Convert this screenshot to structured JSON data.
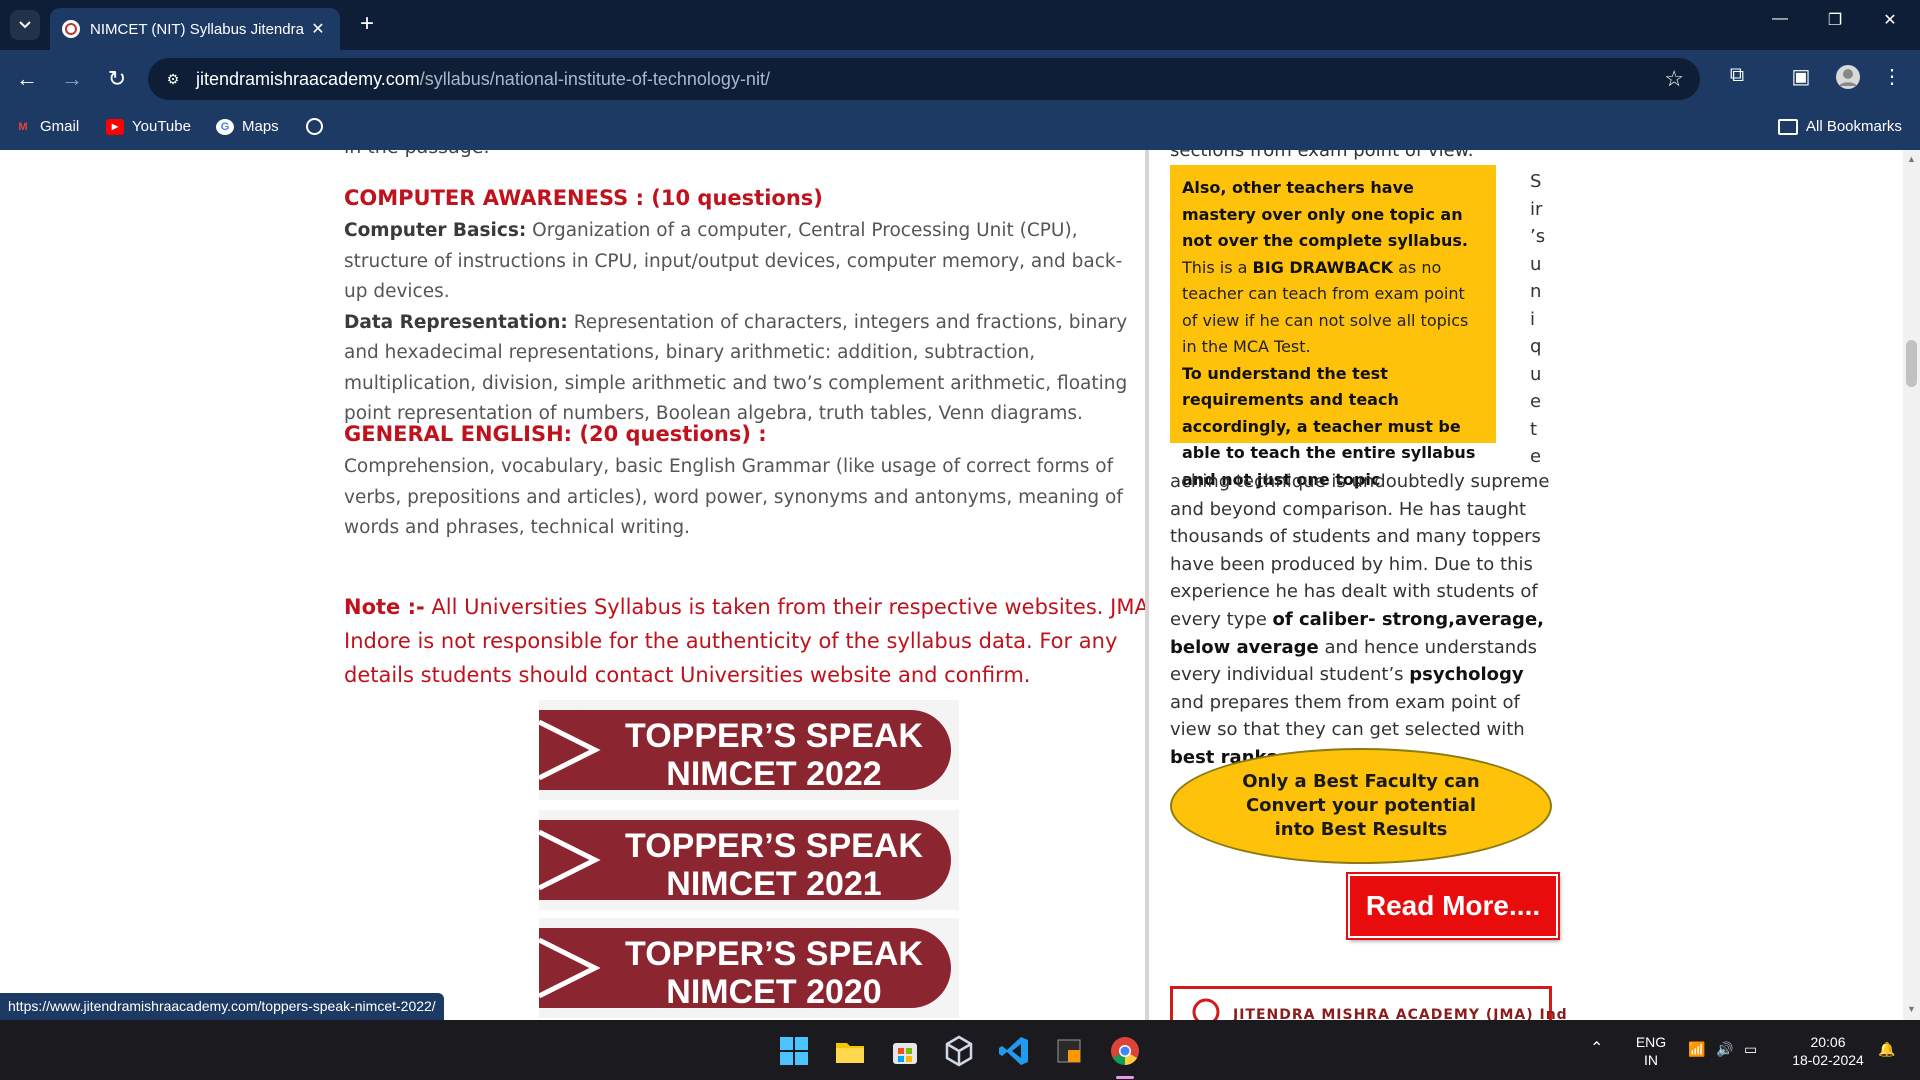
{
  "browser": {
    "tab_title": "NIMCET (NIT) Syllabus Jitendra",
    "url_domain": "jitendramishraacademy.com",
    "url_path": "/syllabus/national-institute-of-technology-nit/",
    "bookmarks": [
      {
        "label": "Gmail"
      },
      {
        "label": "YouTube"
      },
      {
        "label": "Maps"
      }
    ],
    "all_bookmarks": "All Bookmarks"
  },
  "main": {
    "top_fragment": "in the passage.",
    "computer_awareness": {
      "heading": "COMPUTER AWARENESS : (10 questions)",
      "basics_label": "Computer Basics:",
      "basics_text": " Organization of a computer, Central Processing Unit (CPU), structure of instructions in CPU, input/output devices, computer memory, and back-up devices.",
      "data_label": "Data Representation:",
      "data_text": " Representation of characters, integers and fractions, binary and hexadecimal representations, binary arithmetic: addition, subtraction, multiplication, division, simple arithmetic and two’s complement arithmetic, floating point representation of numbers, Boolean algebra, truth tables, Venn diagrams."
    },
    "general_english": {
      "heading": "GENERAL ENGLISH: (20 questions) :",
      "text": "Comprehension, vocabulary, basic English Grammar (like usage of correct forms of verbs, prepositions and articles), word power, synonyms and antonyms, meaning of words and phrases, technical writing."
    },
    "note": {
      "label": "Note :-",
      "text": " All Universities Syllabus is taken from their respective websites. JMA Indore is not responsible for the authenticity of the syllabus data. For any details students should contact Universities website and confirm."
    },
    "banners": [
      {
        "line1": "TOPPER’S SPEAK",
        "line2": "NIMCET 2022"
      },
      {
        "line1": "TOPPER’S SPEAK",
        "line2": "NIMCET 2021"
      },
      {
        "line1": "TOPPER’S SPEAK",
        "line2": "NIMCET 2020"
      }
    ]
  },
  "sidebar": {
    "top_fragment": "sections from exam point of view.",
    "yellow_box": {
      "bold1": "Also, other teachers have mastery over only one topic an not over the complete syllabus.",
      "normal1": " This is a ",
      "bold2": "BIG DRAWBACK",
      "normal2": " as no teacher can teach from exam point of view if he can not solve all topics in the MCA Test.",
      "bold3": "To understand the test requirements and teach accordingly, a teacher must be able to teach the entire syllabus and not just one topic"
    },
    "vertical_letters": [
      "S",
      "ir",
      "’s",
      "u",
      "n",
      "i",
      "q",
      "u",
      "e",
      "t",
      "e"
    ],
    "bio": {
      "p1": "aching technique is undoubtedly supreme and beyond comparison. He has taught thousands of students and many toppers have been produced by him. Due to this experience he has dealt with students of every type ",
      "b1": "of caliber- strong,average, below average",
      "p2": " and hence understands every individual student’s ",
      "b2": "psychology",
      "p3": " and prepares them from exam point of view so that they can get selected with ",
      "b3": "best ranks."
    },
    "oval_text": "Only a Best Faculty can Convert your potential into Best Results",
    "read_more": "Read More....",
    "logo_text": "JITENDRA MISHRA ACADEMY (JMA) Ind"
  },
  "status_url": "https://www.jitendramishraacademy.com/toppers-speak-nimcet-2022/",
  "taskbar": {
    "lang1": "ENG",
    "lang2": "IN",
    "time": "20:06",
    "date": "18-02-2024"
  },
  "colors": {
    "heading_red": "#c0121c",
    "banner_red": "#8b2530",
    "highlight_yellow": "#ffc20a",
    "chrome_dark": "#0d1e36",
    "chrome_blue": "#1c3a63"
  }
}
